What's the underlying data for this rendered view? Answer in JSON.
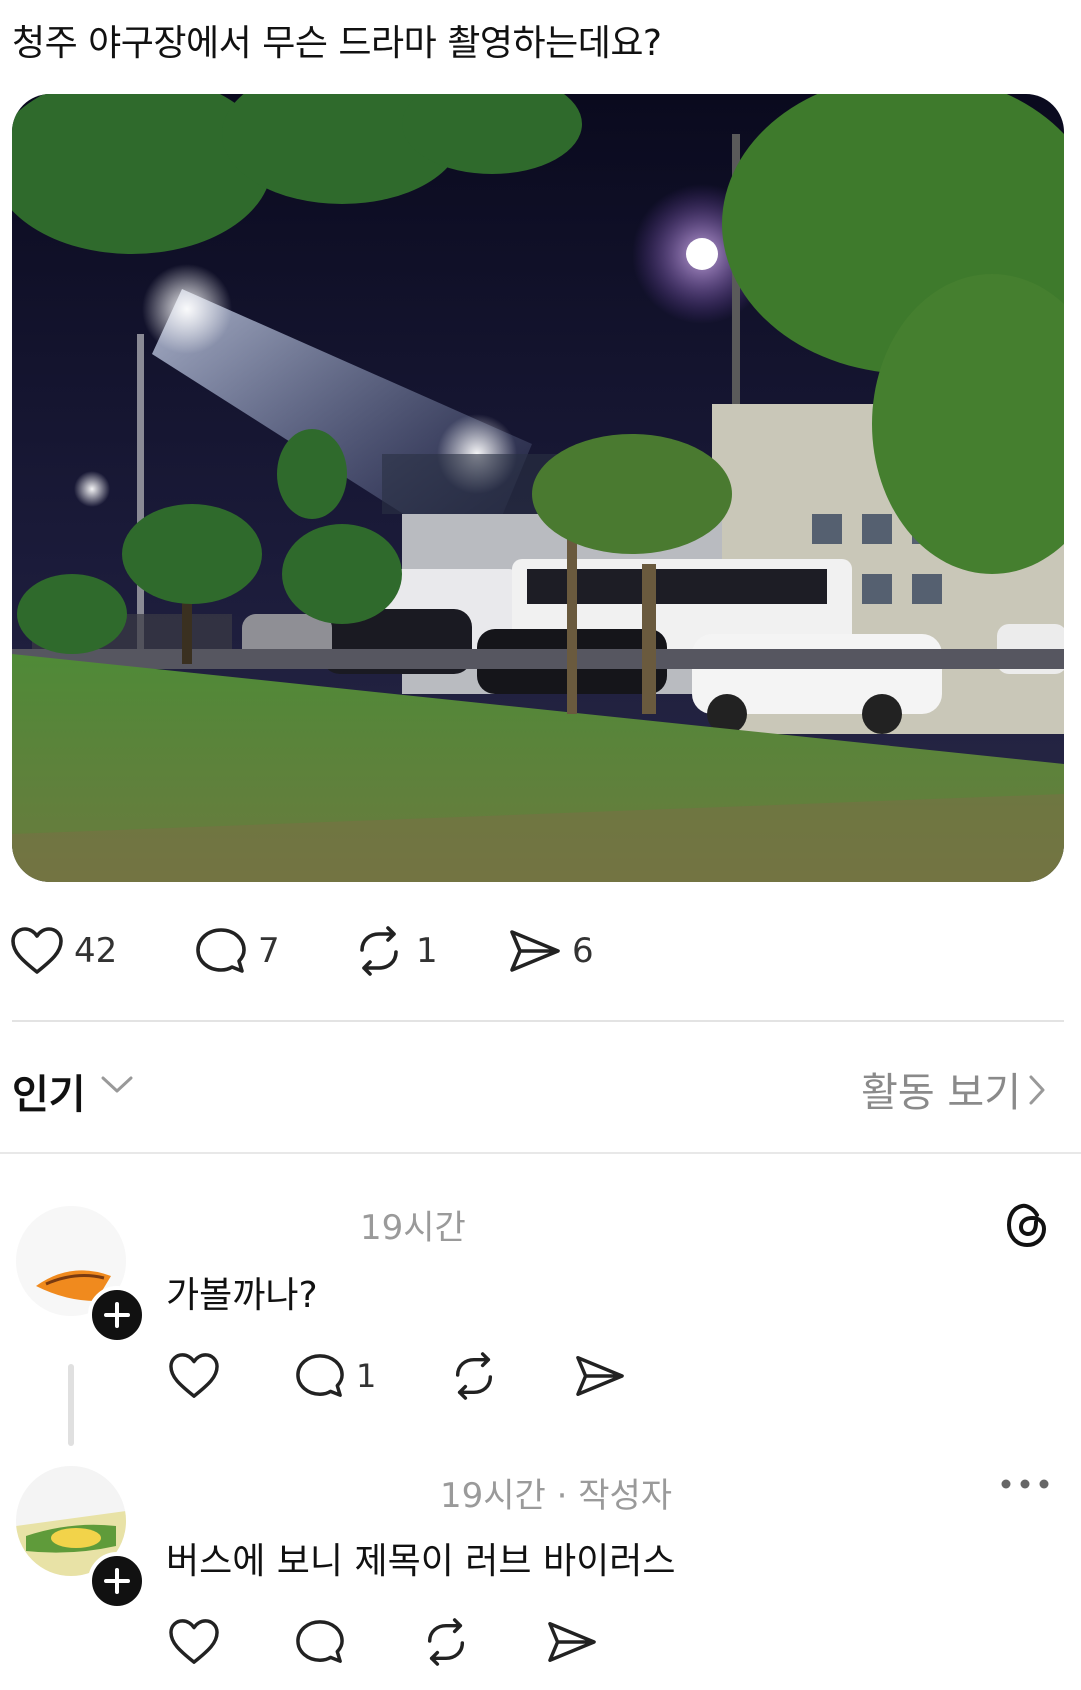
{
  "post": {
    "text": "청주 야구장에서 무슨 드라마 촬영하는데요?",
    "actions": {
      "likes": "42",
      "comments": "7",
      "reposts": "1",
      "shares": "6"
    }
  },
  "replies_header": {
    "sort_label": "인기",
    "activity_label": "활동 보기"
  },
  "comments": [
    {
      "time": "19시간",
      "text": "가볼까나?",
      "comment_count": "1"
    },
    {
      "time": "19시간 · 작성자",
      "text": "버스에 보니 제목이  러브 바이러스"
    }
  ],
  "icons": {
    "like": "heart-icon",
    "comment": "speech-bubble-icon",
    "repost": "repost-icon",
    "share": "paper-plane-icon",
    "more": "more-dots-icon",
    "app": "threads-logo-icon",
    "follow": "plus-icon"
  }
}
